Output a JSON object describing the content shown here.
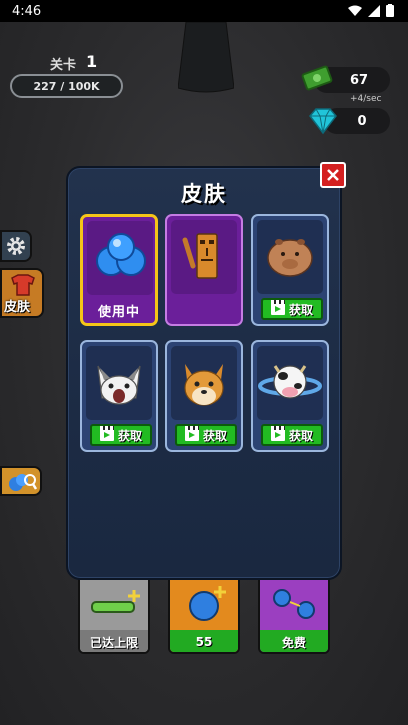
{
  "status_bar": {
    "time": "4:46"
  },
  "hud": {
    "level_label": "关卡",
    "level_number": "1",
    "progress_text": "227 / 100K",
    "money_value": "67",
    "money_rate": "+4/sec",
    "gem_value": "0"
  },
  "side_buttons": {
    "skins_label": "皮肤"
  },
  "bottom_cards": [
    {
      "label": "已达上限",
      "icon": "slider-bar-icon",
      "color": "#8a8a8a"
    },
    {
      "label": "55",
      "icon": "blue-ball-plus-icon",
      "color": "#e38a1e"
    },
    {
      "label": "免费",
      "icon": "split-balls-icon",
      "color": "#9b3fc0"
    }
  ],
  "modal": {
    "title": "皮肤",
    "skins": [
      {
        "name": "blue-balls",
        "icon": "blue-balls-icon",
        "status": "使用中"
      },
      {
        "name": "tiki-bat",
        "icon": "tiki-figure-icon",
        "status": ""
      },
      {
        "name": "capybara",
        "icon": "capybara-icon",
        "action": "获取"
      },
      {
        "name": "screaming-cat",
        "icon": "cat-face-icon",
        "action": "获取"
      },
      {
        "name": "doge",
        "icon": "shiba-face-icon",
        "action": "获取"
      },
      {
        "name": "planet-cow",
        "icon": "cow-planet-icon",
        "action": "获取"
      }
    ]
  },
  "colors": {
    "accent_gold": "#f5c518",
    "get_button_green": "#22bb22",
    "close_red": "#d42020",
    "modal_blue": "#22324d"
  }
}
